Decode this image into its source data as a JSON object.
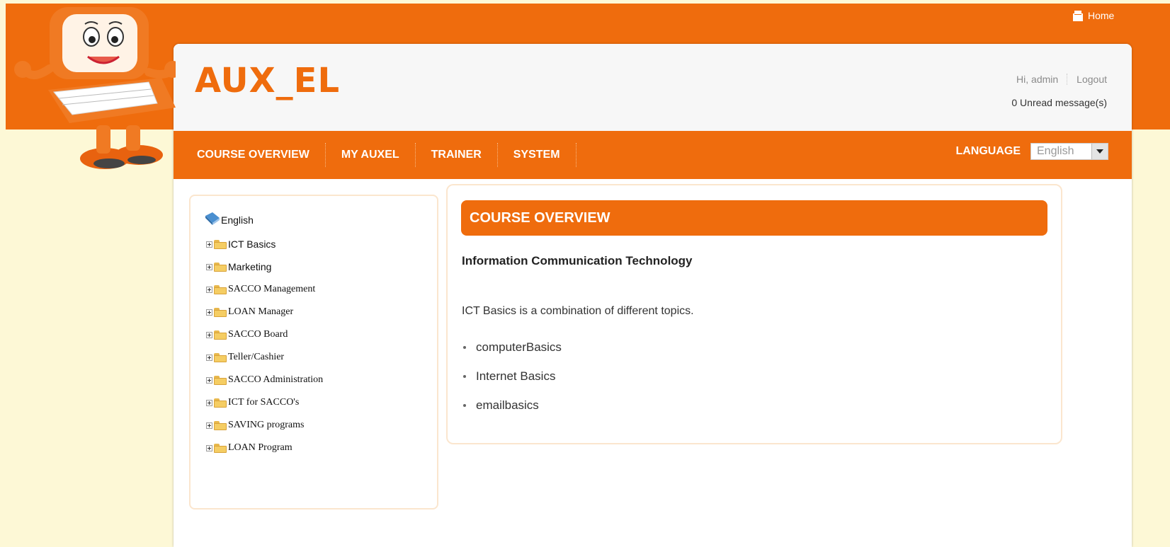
{
  "header": {
    "home_label": "Home",
    "logo_text": "AUX_EL",
    "greeting": "Hi, admin",
    "logout_label": "Logout",
    "unread_messages": "0 Unread message(s)"
  },
  "nav": {
    "items": [
      {
        "label": "COURSE OVERVIEW"
      },
      {
        "label": "MY AUXEL"
      },
      {
        "label": "TRAINER"
      },
      {
        "label": "SYSTEM"
      }
    ],
    "language_label": "LANGUAGE",
    "language_selected": "English"
  },
  "sidebar": {
    "root_label": "English",
    "items": [
      {
        "label": "ICT Basics"
      },
      {
        "label": "Marketing"
      },
      {
        "label": "SACCO Management"
      },
      {
        "label": "LOAN Manager"
      },
      {
        "label": "SACCO Board"
      },
      {
        "label": "Teller/Cashier"
      },
      {
        "label": "SACCO Administration"
      },
      {
        "label": "ICT for SACCO's"
      },
      {
        "label": "SAVING programs"
      },
      {
        "label": "LOAN Program"
      }
    ]
  },
  "main": {
    "panel_title": "COURSE OVERVIEW",
    "course_name": "Information Communication Technology",
    "description": "ICT Basics is a combination of different topics.",
    "topics": [
      "computerBasics",
      "Internet Basics",
      "emailbasics"
    ]
  },
  "colors": {
    "accent": "#ef6c0d",
    "page_background": "#fdf8d6",
    "header_background": "#f7f7f7",
    "panel_border": "#fbe6ce"
  }
}
